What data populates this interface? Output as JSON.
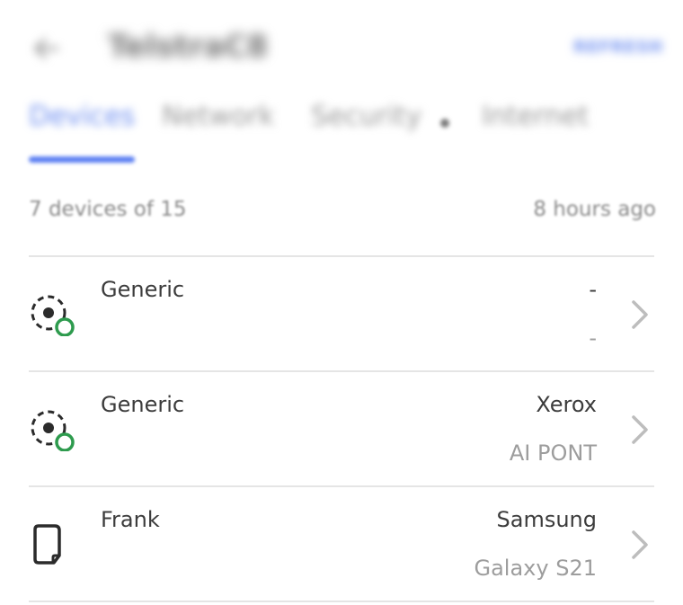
{
  "header": {
    "title": "TelstraC8",
    "action_label": "REFRESH"
  },
  "tabs": [
    {
      "label": "Devices",
      "active": true
    },
    {
      "label": "Network",
      "active": false
    },
    {
      "label": "Security",
      "active": false,
      "badge_dot": true
    },
    {
      "label": "Internet",
      "active": false
    }
  ],
  "summary": {
    "count_text": "7 devices of 15",
    "updated_text": "8 hours ago"
  },
  "devices": [
    {
      "name": "Generic",
      "subtitle": "",
      "brand": "-",
      "model": "-",
      "icon": "generic-device-online-icon"
    },
    {
      "name": "Generic",
      "subtitle": "",
      "brand": "Xerox",
      "model": "AI PONT",
      "icon": "generic-device-online-icon"
    },
    {
      "name": "Frank",
      "subtitle": "",
      "brand": "Samsung",
      "model": "Galaxy S21",
      "icon": "tablet-icon"
    }
  ],
  "colors": {
    "accent": "#5b7ff2",
    "online": "#2e9b4e",
    "text_primary": "#3c3c3c",
    "text_secondary": "#9d9d9d",
    "divider": "#e5e5e5"
  }
}
